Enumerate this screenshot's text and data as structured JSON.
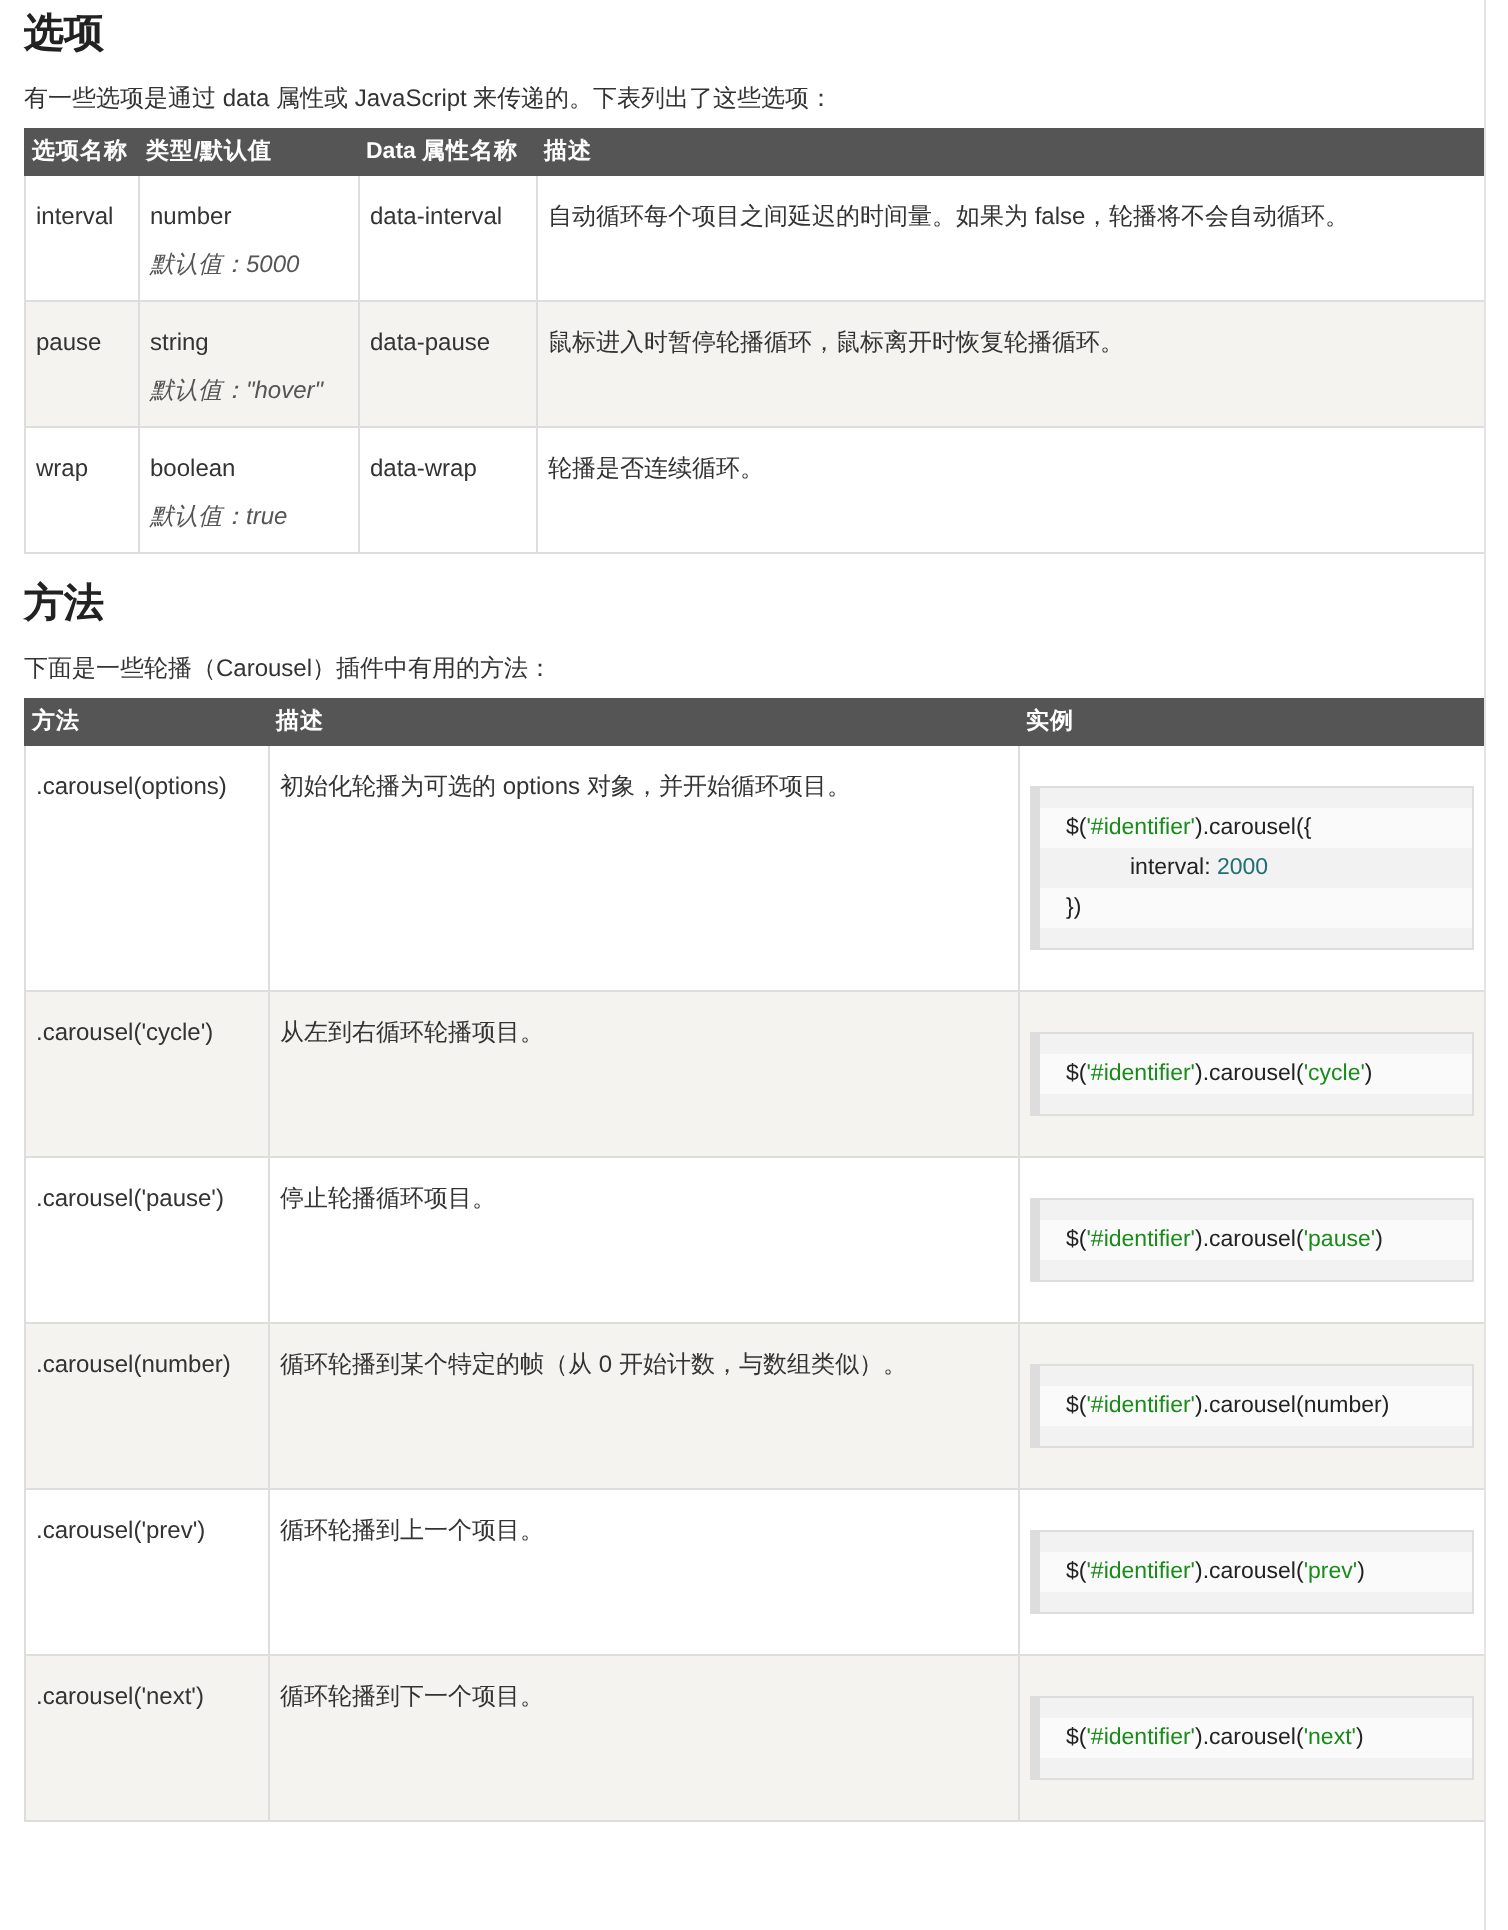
{
  "options_section": {
    "heading": "选项",
    "intro": "有一些选项是通过 data 属性或 JavaScript 来传递的。下表列出了这些选项：",
    "table": {
      "columns": [
        "选项名称",
        "类型/默认值",
        "Data 属性名称",
        "描述"
      ],
      "rows": [
        {
          "name": "interval",
          "type": "number",
          "default": "默认值：5000",
          "attribute": "data-interval",
          "description": "自动循环每个项目之间延迟的时间量。如果为 false，轮播将不会自动循环。"
        },
        {
          "name": "pause",
          "type": "string",
          "default": "默认值：\"hover\"",
          "attribute": "data-pause",
          "description": "鼠标进入时暂停轮播循环，鼠标离开时恢复轮播循环。"
        },
        {
          "name": "wrap",
          "type": "boolean",
          "default": "默认值：true",
          "attribute": "data-wrap",
          "description": "轮播是否连续循环。"
        }
      ]
    }
  },
  "methods_section": {
    "heading": "方法",
    "intro": "下面是一些轮播（Carousel）插件中有用的方法：",
    "table": {
      "columns": [
        "方法",
        "描述",
        "实例"
      ],
      "rows": [
        {
          "method": ".carousel(options)",
          "description": "初始化轮播为可选的 options 对象，并开始循环项目。",
          "example": [
            {
              "indent": false,
              "tokens": [
                {
                  "text": "$(",
                  "kind": "plain"
                },
                {
                  "text": "'#identifier'",
                  "kind": "string"
                },
                {
                  "text": ").carousel({",
                  "kind": "plain"
                }
              ]
            },
            {
              "indent": true,
              "tokens": [
                {
                  "text": "interval: ",
                  "kind": "plain"
                },
                {
                  "text": "2000",
                  "kind": "number"
                }
              ]
            },
            {
              "indent": false,
              "tokens": [
                {
                  "text": "})",
                  "kind": "plain"
                }
              ]
            }
          ]
        },
        {
          "method": ".carousel('cycle')",
          "description": "从左到右循环轮播项目。",
          "example": [
            {
              "indent": false,
              "tokens": [
                {
                  "text": "$(",
                  "kind": "plain"
                },
                {
                  "text": "'#identifier'",
                  "kind": "string"
                },
                {
                  "text": ").carousel(",
                  "kind": "plain"
                },
                {
                  "text": "'cycle'",
                  "kind": "string"
                },
                {
                  "text": ")",
                  "kind": "plain"
                }
              ]
            }
          ]
        },
        {
          "method": ".carousel('pause')",
          "description": "停止轮播循环项目。",
          "example": [
            {
              "indent": false,
              "tokens": [
                {
                  "text": "$(",
                  "kind": "plain"
                },
                {
                  "text": "'#identifier'",
                  "kind": "string"
                },
                {
                  "text": ").carousel(",
                  "kind": "plain"
                },
                {
                  "text": "'pause'",
                  "kind": "string"
                },
                {
                  "text": ")",
                  "kind": "plain"
                }
              ]
            }
          ]
        },
        {
          "method": ".carousel(number)",
          "description": "循环轮播到某个特定的帧（从 0 开始计数，与数组类似）。",
          "example": [
            {
              "indent": false,
              "tokens": [
                {
                  "text": "$(",
                  "kind": "plain"
                },
                {
                  "text": "'#identifier'",
                  "kind": "string"
                },
                {
                  "text": ").carousel(number)",
                  "kind": "plain"
                }
              ]
            }
          ]
        },
        {
          "method": ".carousel('prev')",
          "description": "循环轮播到上一个项目。",
          "example": [
            {
              "indent": false,
              "tokens": [
                {
                  "text": "$(",
                  "kind": "plain"
                },
                {
                  "text": "'#identifier'",
                  "kind": "string"
                },
                {
                  "text": ").carousel(",
                  "kind": "plain"
                },
                {
                  "text": "'prev'",
                  "kind": "string"
                },
                {
                  "text": ")",
                  "kind": "plain"
                }
              ]
            }
          ]
        },
        {
          "method": ".carousel('next')",
          "description": "循环轮播到下一个项目。",
          "example": [
            {
              "indent": false,
              "tokens": [
                {
                  "text": "$(",
                  "kind": "plain"
                },
                {
                  "text": "'#identifier'",
                  "kind": "string"
                },
                {
                  "text": ").carousel(",
                  "kind": "plain"
                },
                {
                  "text": "'next'",
                  "kind": "string"
                },
                {
                  "text": ")",
                  "kind": "plain"
                }
              ]
            }
          ]
        }
      ]
    }
  }
}
